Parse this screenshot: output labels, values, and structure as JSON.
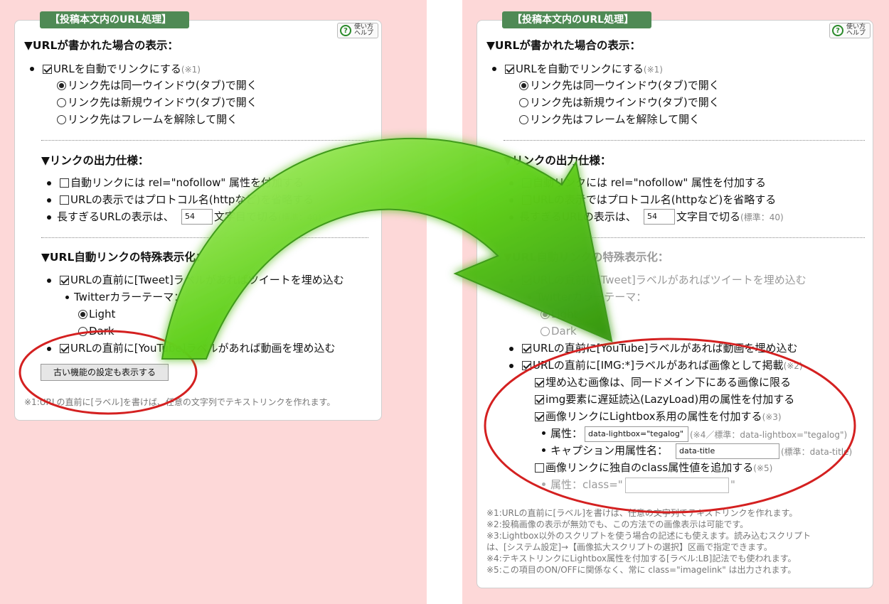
{
  "section_title": "【投稿本文内のURL処理】",
  "help_button": "使い方ヘルプ",
  "help_line1": "使い方",
  "help_line2": "ヘルプ",
  "heading_display": "▼URLが書かれた場合の表示：",
  "auto_link": "URLを自動でリンクにする",
  "note1": "(※1)",
  "radio_same": "リンク先は同一ウインドウ(タブ)で開く",
  "radio_new": "リンク先は新規ウインドウ(タブ)で開く",
  "radio_frame": "リンク先はフレームを解除して開く",
  "heading_output": "▼リンクの出力仕様：",
  "nofollow": "自動リンクには rel=\"nofollow\" 属性を付加する",
  "omit_protocol": "URLの表示ではプロトコル名(httpなど)を省略する",
  "long_url_prefix": "長すぎるURLの表示は、",
  "long_url_value": "54",
  "long_url_suffix": "文字目で切る",
  "long_url_note": "(標準：40)",
  "heading_special": "▼URL自動リンクの特殊表示化：",
  "tweet": "URLの直前に[Tweet]ラベルがあればツイートを埋め込む",
  "twitter_theme": "Twitterカラーテーマ：",
  "theme_light": "Light",
  "theme_dark": "Dark",
  "youtube": "URLの直前に[YouTube]ラベルがあれば動画を埋め込む",
  "old_settings_button": "古い機能の設定も表示する",
  "left_footnote": "※1:URLの直前に[ラベル]を書けば、任意の文字列でテキストリンクを作れます。",
  "img_label": "URLの直前に[IMG:*]ラベルがあれば画像として掲載",
  "note2": "(※2)",
  "same_domain": "埋め込む画像は、同一ドメイン下にある画像に限る",
  "lazyload": "img要素に遅延読込(LazyLoad)用の属性を付加する",
  "lightbox": "画像リンクにLightbox系用の属性を付加する",
  "note3": "(※3)",
  "attr_label": "属性：",
  "attr_value": "data-lightbox=\"tegalog\"",
  "attr_note": "(※4／標準：data-lightbox=\"tegalog\")",
  "caption_label": "キャプション用属性名：",
  "caption_value": "data-title",
  "caption_note": "(標準：data-title)",
  "class_attr": "画像リンクに独自のclass属性値を追加する",
  "note5": "(※5)",
  "class_prefix": "属性：class=\"",
  "class_suffix": "\"",
  "footnotes": [
    "※1:URLの直前に[ラベル]を書けば、任意の文字列でテキストリンクを作れます。",
    "※2:投稿画像の表示が無効でも、この方法での画像表示は可能です。",
    "※3:Lightbox以外のスクリプトを使う場合の記述にも使えます。読み込むスクリプト",
    "は、[システム設定]→【画像拡大スクリプトの選択】区画で指定できます。",
    "※4:テキストリンクにLightbox属性を付加する[ラベル:LB]記法でも使われます。",
    "※5:この項目のON/OFFに関係なく、常に class=\"imagelink\" は出力されます。"
  ],
  "colors": {
    "background_pink": "#fdd8d8",
    "title_green": "#4f8a55",
    "arrow_green": "#5fcf1a",
    "highlight_red": "#d42020"
  }
}
